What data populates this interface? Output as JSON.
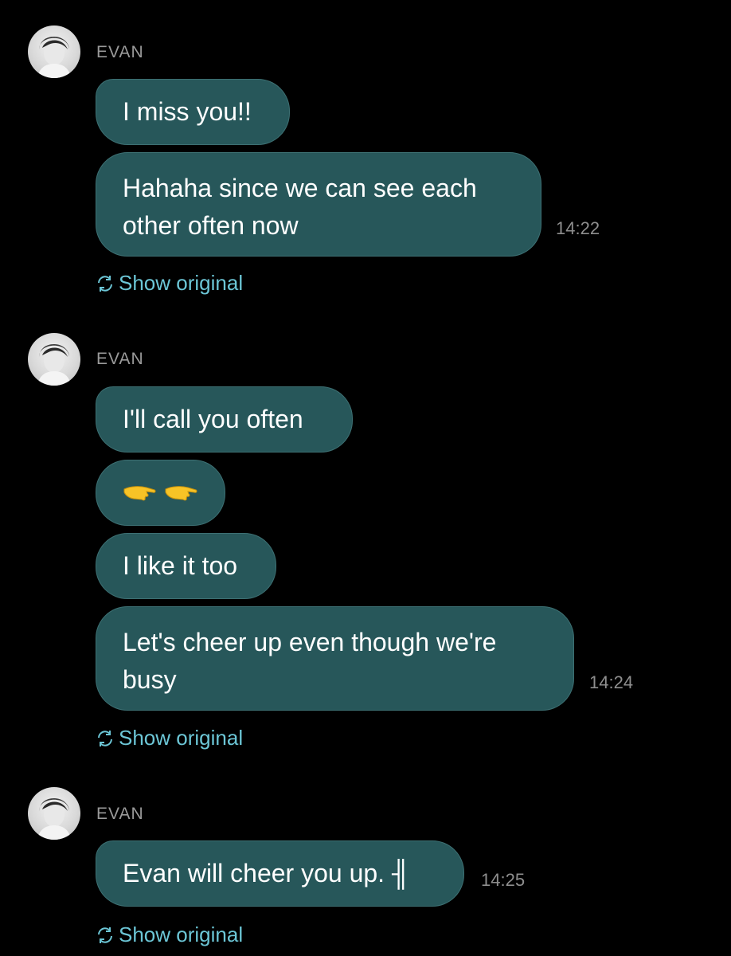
{
  "groups": [
    {
      "sender": "EVAN",
      "messages": [
        "I miss you!!",
        "Hahaha since we can see each other often now"
      ],
      "time": "14:22",
      "show_original": "Show original"
    },
    {
      "sender": "EVAN",
      "messages": [
        "I'll call you often",
        "",
        "I like it too",
        "Let's cheer up even though we're busy"
      ],
      "time": "14:24",
      "show_original": "Show original"
    },
    {
      "sender": "EVAN",
      "messages": [
        "Evan will cheer you up. ╢"
      ],
      "time": "14:25",
      "show_original": "Show original"
    }
  ],
  "emoji_message_icons": [
    "backhand-pointing-hand-icon",
    "backhand-pointing-hand-icon"
  ],
  "colors": {
    "background": "#000000",
    "bubble": "#27575a",
    "bubble_border": "#3d7073",
    "sender": "#9a9a9a",
    "timestamp": "#8e8e8e",
    "link": "#6cc6d6"
  }
}
